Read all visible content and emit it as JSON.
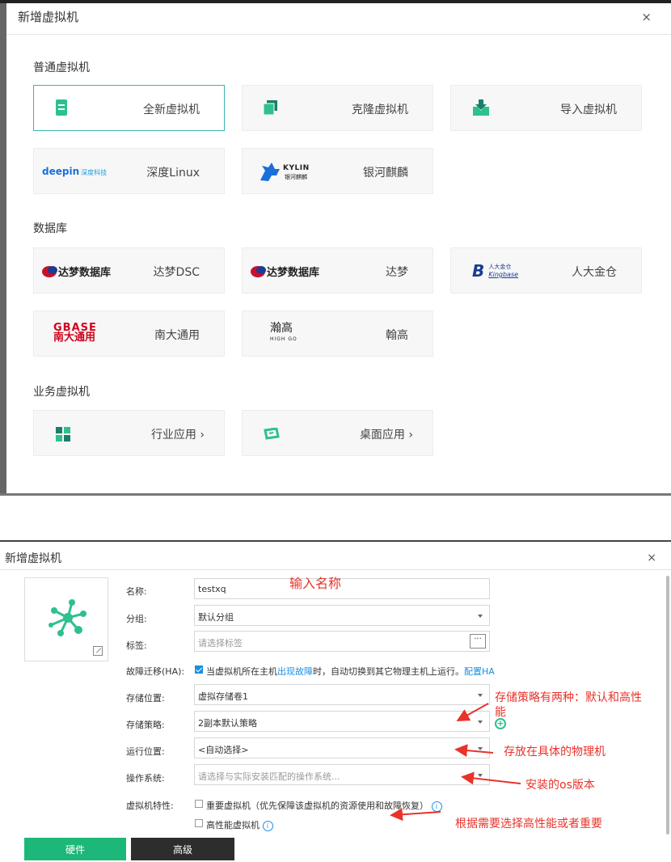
{
  "dialog1": {
    "title": "新增虚拟机",
    "close": "×",
    "sections": [
      {
        "title": "普通虚拟机"
      },
      {
        "title": "数据库"
      },
      {
        "title": "业务虚拟机"
      }
    ],
    "cards": {
      "new_vm": "全新虚拟机",
      "clone_vm": "克隆虚拟机",
      "import_vm": "导入虚拟机",
      "deepin": "深度Linux",
      "deepin_logo_en": "deepin",
      "deepin_logo_cn": "深度科技",
      "kylin": "银河麒麟",
      "kylin_logo_en": "KYLIN",
      "kylin_logo_cn": "银河麒麟",
      "dm_dsc": "达梦DSC",
      "dm_logo": "达梦数据库",
      "dm": "达梦",
      "kingbase": "人大金仓",
      "kingbase_logo_cn": "人大金仓",
      "kingbase_logo_en": "Kingbase",
      "gbase": "南大通用",
      "gbase_logo_en": "GBASE",
      "gbase_logo_cn": "南大通用",
      "highgo": "翰高",
      "highgo_logo_cn": "瀚高",
      "highgo_logo_en": "HIGH GO",
      "industry": "行业应用",
      "desktop": "桌面应用",
      "chevron": "›"
    },
    "accent": "#3bb5b0",
    "icon_green": "#2ec08f"
  },
  "dialog2": {
    "title": "新增虚拟机",
    "close": "×",
    "fields": {
      "name_label": "名称:",
      "name_value": "testxq",
      "group_label": "分组:",
      "group_value": "默认分组",
      "tag_label": "标签:",
      "tag_placeholder": "请选择标签",
      "tag_more": "···",
      "ha_label": "故障迁移(HA):",
      "ha_text_1": "当虚拟机所在主机",
      "ha_text_link": "出现故障",
      "ha_text_2": "时，自动切换到其它物理主机上运行。",
      "ha_config": "配置HA",
      "storage_label": "存储位置:",
      "storage_value": "虚拟存储卷1",
      "policy_label": "存储策略:",
      "policy_value": "2副本默认策略",
      "run_label": "运行位置:",
      "run_value": "<自动选择>",
      "os_label": "操作系统:",
      "os_placeholder": "请选择与实际安装匹配的操作系统...",
      "feature_label": "虚拟机特性:",
      "important_vm": "重要虚拟机（优先保障该虚拟机的资源使用和故障恢复）",
      "high_perf_vm": "高性能虚拟机"
    },
    "tabs": {
      "hardware": "硬件",
      "advanced": "高级"
    },
    "annotations": {
      "name": "输入名称",
      "policy_1": "存储策略有两种：默认和高性",
      "policy_2": "能",
      "run": "存放在具体的物理机",
      "os": "安装的os版本",
      "feature": "根据需要选择高性能或者重要"
    },
    "colors": {
      "primary": "#1db879",
      "annotation": "#e8332a",
      "link": "#1a8fe0"
    }
  }
}
